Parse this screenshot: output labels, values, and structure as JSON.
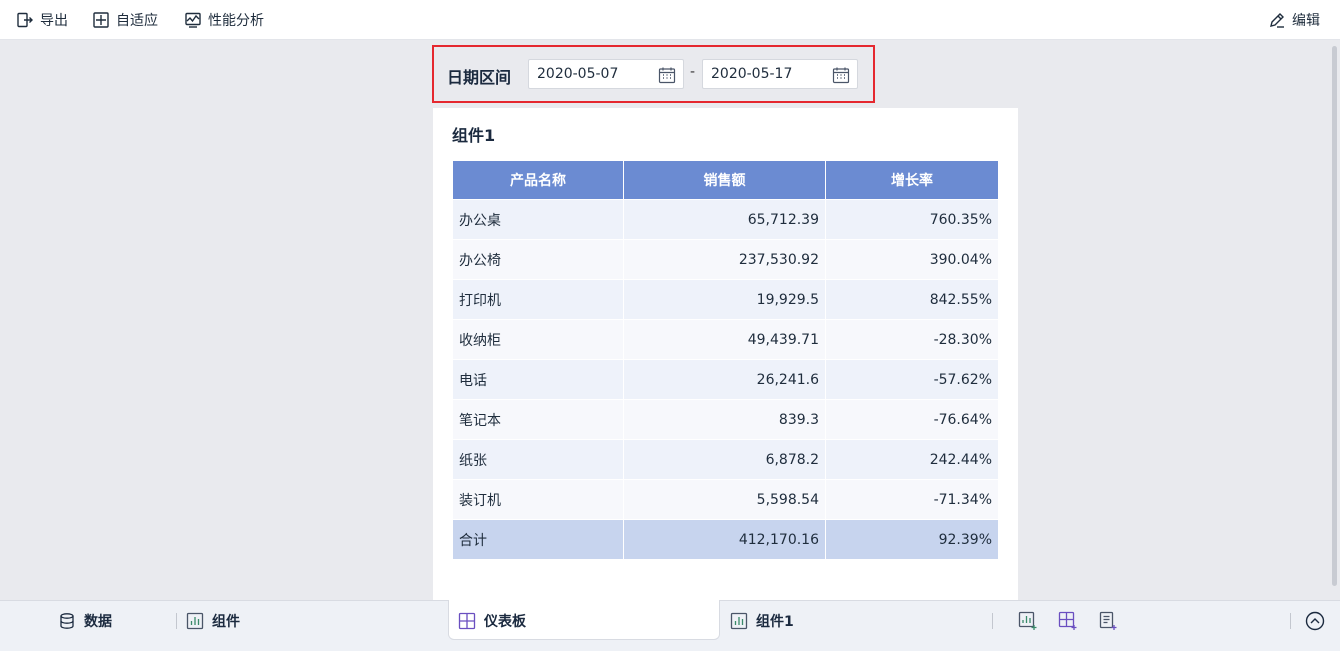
{
  "toolbar": {
    "export_label": "导出",
    "adapt_label": "自适应",
    "perf_label": "性能分析",
    "edit_label": "编辑"
  },
  "filter": {
    "label": "日期区间",
    "start_date": "2020-05-07",
    "separator": "-",
    "end_date": "2020-05-17",
    "highlight_color": "#e5282f"
  },
  "widget": {
    "title": "组件1",
    "header_color": "#6b8bd2",
    "columns": [
      "产品名称",
      "销售额",
      "增长率"
    ],
    "rows": [
      {
        "name": "办公桌",
        "sales": "65,712.39",
        "growth": "760.35%"
      },
      {
        "name": "办公椅",
        "sales": "237,530.92",
        "growth": "390.04%"
      },
      {
        "name": "打印机",
        "sales": "19,929.5",
        "growth": "842.55%"
      },
      {
        "name": "收纳柜",
        "sales": "49,439.71",
        "growth": "-28.30%"
      },
      {
        "name": "电话",
        "sales": "26,241.6",
        "growth": "-57.62%"
      },
      {
        "name": "笔记本",
        "sales": "839.3",
        "growth": "-76.64%"
      },
      {
        "name": "纸张",
        "sales": "6,878.2",
        "growth": "242.44%"
      },
      {
        "name": "装订机",
        "sales": "5,598.54",
        "growth": "-71.34%"
      }
    ],
    "total": {
      "name": "合计",
      "sales": "412,170.16",
      "growth": "92.39%"
    }
  },
  "bottombar": {
    "data_label": "数据",
    "widget_label": "组件",
    "dashboard_label": "仪表板",
    "widget1_label": "组件1",
    "icons": [
      "add-chart-icon",
      "add-grid-icon",
      "add-report-icon",
      "collapse-up-icon"
    ]
  }
}
